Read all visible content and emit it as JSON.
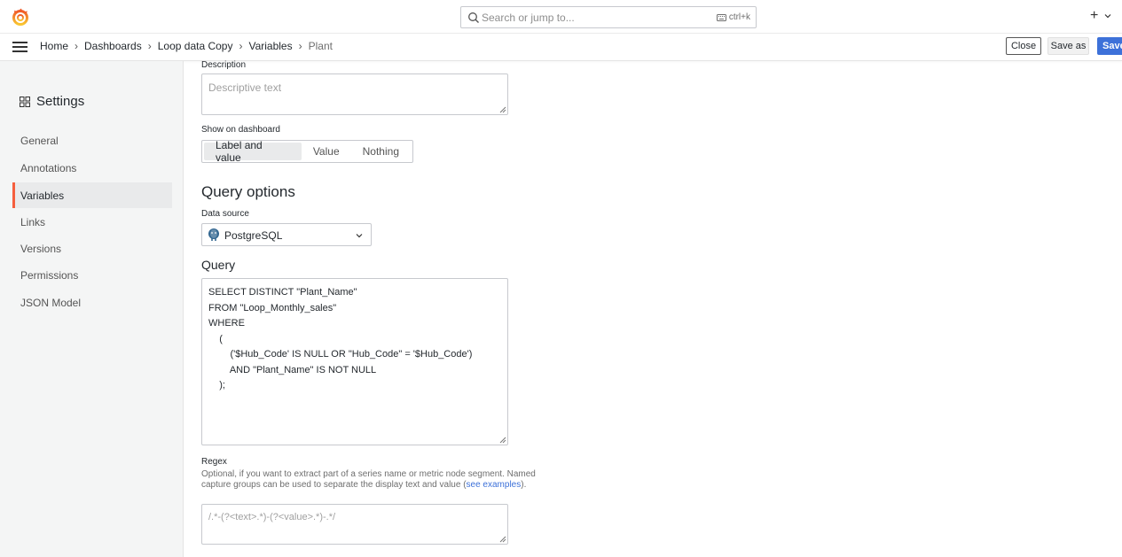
{
  "search": {
    "placeholder": "Search or jump to...",
    "shortcut": "ctrl+k"
  },
  "topbar": {
    "plus": "+"
  },
  "breadcrumb": [
    "Home",
    "Dashboards",
    "Loop data Copy",
    "Variables",
    "Plant"
  ],
  "actions": {
    "close": "Close",
    "save_as": "Save as",
    "save": "Save"
  },
  "sidebar": {
    "title": "Settings",
    "items": [
      "General",
      "Annotations",
      "Variables",
      "Links",
      "Versions",
      "Permissions",
      "JSON Model"
    ],
    "active": "Variables"
  },
  "form": {
    "description_label": "Description",
    "description_placeholder": "Descriptive text",
    "show_label": "Show on dashboard",
    "show_options": [
      "Label and value",
      "Value",
      "Nothing"
    ],
    "query_options_title": "Query options",
    "datasource_label": "Data source",
    "datasource_value": "PostgreSQL",
    "query_title": "Query",
    "query_text": "SELECT DISTINCT \"Plant_Name\"\nFROM \"Loop_Monthly_sales\"\nWHERE\n    (\n        ('$Hub_Code' IS NULL OR \"Hub_Code\" = '$Hub_Code')\n        AND \"Plant_Name\" IS NOT NULL\n    );",
    "regex_label": "Regex",
    "regex_help_1": "Optional, if you want to extract part of a series name or metric node segment. Named capture groups can be used to separate the display text and value (",
    "regex_help_link": "see examples",
    "regex_help_2": ").",
    "regex_placeholder": "/.*-(?<text>.*)-(?<value>.*)-.*/"
  },
  "colors": {
    "accent": "#f55f3e",
    "primary": "#3d71d9"
  }
}
